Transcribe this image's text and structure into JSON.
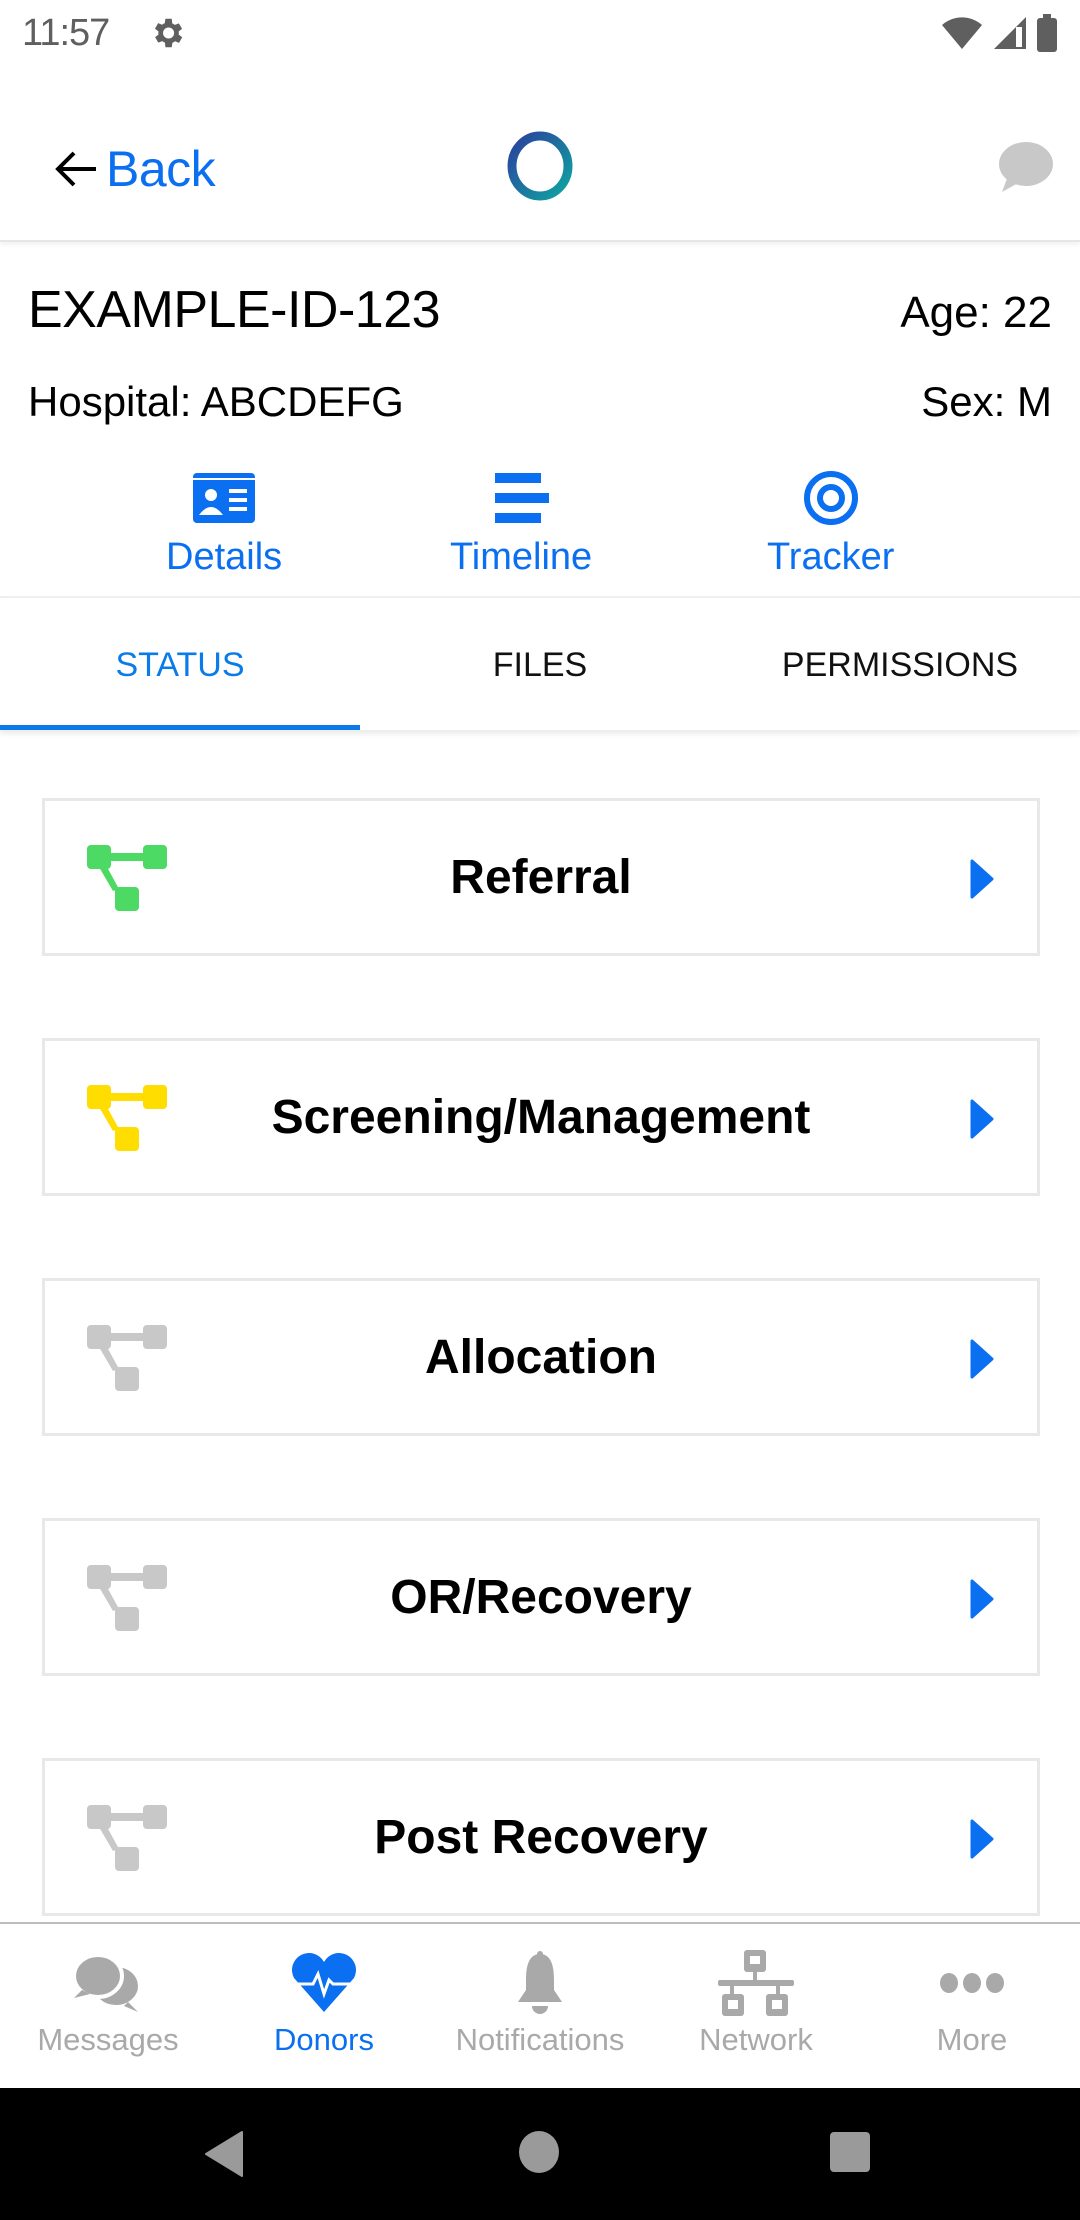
{
  "status_bar": {
    "time": "11:57",
    "icons": [
      "gear-icon",
      "wifi-icon",
      "cell-signal-icon",
      "battery-icon"
    ]
  },
  "app_bar": {
    "back_label": "Back",
    "logo": "app-logo-ring",
    "chat_icon": "chat-bubble-icon"
  },
  "donor": {
    "id": "EXAMPLE-ID-123",
    "age": "Age: 22",
    "hospital": "Hospital: ABCDEFG",
    "sex": "Sex: M"
  },
  "quick_actions": [
    {
      "label": "Details",
      "icon": "id-card-icon"
    },
    {
      "label": "Timeline",
      "icon": "timeline-bars-icon"
    },
    {
      "label": "Tracker",
      "icon": "target-icon"
    }
  ],
  "tabs": [
    {
      "label": "STATUS",
      "active": true
    },
    {
      "label": "FILES",
      "active": false
    },
    {
      "label": "PERMISSIONS",
      "active": false
    }
  ],
  "stages": [
    {
      "title": "Referral",
      "status_color": "#4cd964",
      "state": "complete"
    },
    {
      "title": "Screening/Management",
      "status_color": "#ffdd00",
      "state": "in-progress"
    },
    {
      "title": "Allocation",
      "status_color": "#c8c8c8",
      "state": "pending"
    },
    {
      "title": "OR/Recovery",
      "status_color": "#c8c8c8",
      "state": "pending"
    },
    {
      "title": "Post Recovery",
      "status_color": "#c8c8c8",
      "state": "pending"
    }
  ],
  "bottom_nav": [
    {
      "label": "Messages",
      "icon": "messages-icon",
      "active": false
    },
    {
      "label": "Donors",
      "icon": "heart-pulse-icon",
      "active": true
    },
    {
      "label": "Notifications",
      "icon": "bell-icon",
      "active": false
    },
    {
      "label": "Network",
      "icon": "network-icon",
      "active": false
    },
    {
      "label": "More",
      "icon": "more-dots-icon",
      "active": false
    }
  ],
  "colors": {
    "accent": "#0a6ff0",
    "tab_accent": "#0a7be8",
    "inactive": "#a9a9a9",
    "card_border": "#e8e8e8"
  }
}
